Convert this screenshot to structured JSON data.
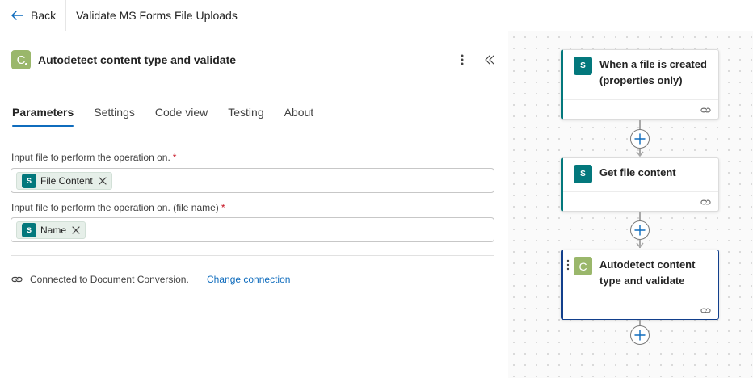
{
  "topbar": {
    "back_label": "Back",
    "flow_title": "Validate MS Forms File Uploads"
  },
  "panel": {
    "icon_letter": "C",
    "title": "Autodetect content type and validate",
    "tabs": [
      {
        "label": "Parameters",
        "active": true
      },
      {
        "label": "Settings",
        "active": false
      },
      {
        "label": "Code view",
        "active": false
      },
      {
        "label": "Testing",
        "active": false
      },
      {
        "label": "About",
        "active": false
      }
    ],
    "fields": [
      {
        "label": "Input file to perform the operation on.",
        "required_mark": "*",
        "token_icon": "S",
        "token_text": "File Content"
      },
      {
        "label": "Input file to perform the operation on. (file name)",
        "required_mark": "*",
        "token_icon": "S",
        "token_text": "Name"
      }
    ],
    "connection_text": "Connected to Document Conversion.",
    "change_connection_label": "Change connection"
  },
  "canvas": {
    "cards": [
      {
        "title": "When a file is created (properties only)",
        "icon_letter": "S"
      },
      {
        "title": "Get file content",
        "icon_letter": "S"
      },
      {
        "title": "Autodetect content type and validate",
        "icon_letter": "C"
      }
    ]
  },
  "colors": {
    "accent": "#0f6cbd",
    "sharepoint": "#03787c",
    "document_conversion": "#9ab76b",
    "selected_border": "#123f8c",
    "required": "#c50f1f"
  }
}
